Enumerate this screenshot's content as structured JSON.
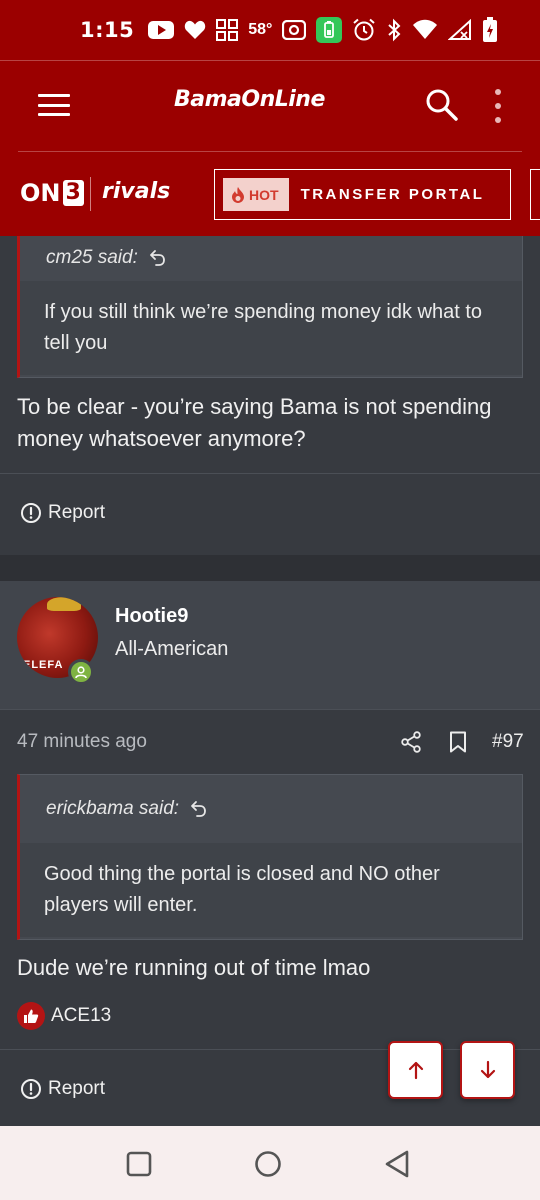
{
  "status_bar": {
    "time": "1:15",
    "temperature": "58°",
    "icons": [
      "youtube-icon",
      "heart-icon",
      "grid-icon",
      "temperature",
      "nfc-icon",
      "battery-saver-icon",
      "alarm-icon",
      "bluetooth-icon",
      "wifi-icon",
      "signal-icon",
      "battery-charging-icon"
    ]
  },
  "header": {
    "logo_text": "BamaOnLine",
    "on3_text": "ON",
    "on3_number": "3",
    "rivals_text": "rivals",
    "hot_label": "HOT",
    "portal_label": "TRANSFER PORTAL"
  },
  "post_1": {
    "quote": {
      "author": "cm25 said:",
      "text": "If you still think we’re spending money idk what to tell you"
    },
    "body": "To be clear - you’re saying Bama is not spending money whatsoever anymore?",
    "report_label": "Report"
  },
  "post_2": {
    "user": {
      "name": "Hootie9",
      "title": "All-American",
      "avatar_text": "ELEFA"
    },
    "timestamp": "47 minutes ago",
    "post_number": "#97",
    "quote": {
      "author": "erickbama said:",
      "text": "Good thing the portal is closed and NO other players will enter."
    },
    "body": "Dude we’re running out of time lmao",
    "reaction_user": "ACE13",
    "report_label": "Report"
  },
  "colors": {
    "brand": "#9b0000",
    "accent": "#b31414",
    "background": "#373a40",
    "online": "#7fb342"
  }
}
